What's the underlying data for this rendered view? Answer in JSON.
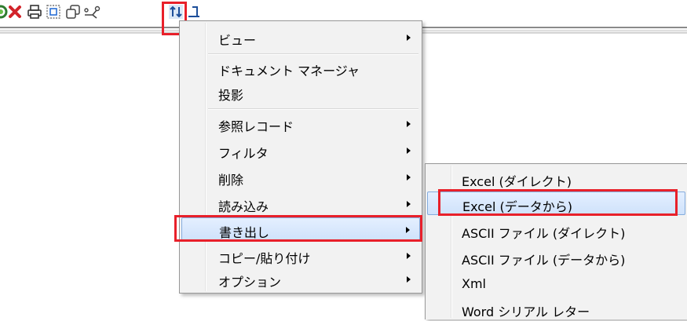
{
  "toolbar": {
    "icons": [
      "refresh-icon",
      "delete-icon",
      "print-icon",
      "select-icon",
      "copy-icon",
      "network-icon",
      "sort-icon",
      "export-icon"
    ]
  },
  "main_menu": {
    "items": [
      {
        "label": "ビュー",
        "submenu": true
      },
      {
        "label": "ドキュメント マネージャ",
        "submenu": false
      },
      {
        "label": "投影",
        "submenu": false
      },
      {
        "label": "参照レコード",
        "submenu": true
      },
      {
        "label": "フィルタ",
        "submenu": true
      },
      {
        "label": "削除",
        "submenu": true
      },
      {
        "label": "読み込み",
        "submenu": true
      },
      {
        "label": "書き出し",
        "submenu": true,
        "highlighted": true
      },
      {
        "label": "コピー/貼り付け",
        "submenu": true
      },
      {
        "label": "オプション",
        "submenu": true
      }
    ]
  },
  "export_submenu": {
    "items": [
      {
        "label": "Excel (ダイレクト)"
      },
      {
        "label": "Excel (データから)",
        "highlighted": true
      },
      {
        "label": "ASCII ファイル (ダイレクト)"
      },
      {
        "label": "ASCII ファイル (データから)"
      },
      {
        "label": "Xml"
      },
      {
        "label": "Word シリアル レター"
      }
    ]
  },
  "colors": {
    "highlight_box": "#e8202a",
    "menu_background": "#f2f2f2",
    "hover_background": "#cfe2fb",
    "hover_border": "#84acdd"
  }
}
